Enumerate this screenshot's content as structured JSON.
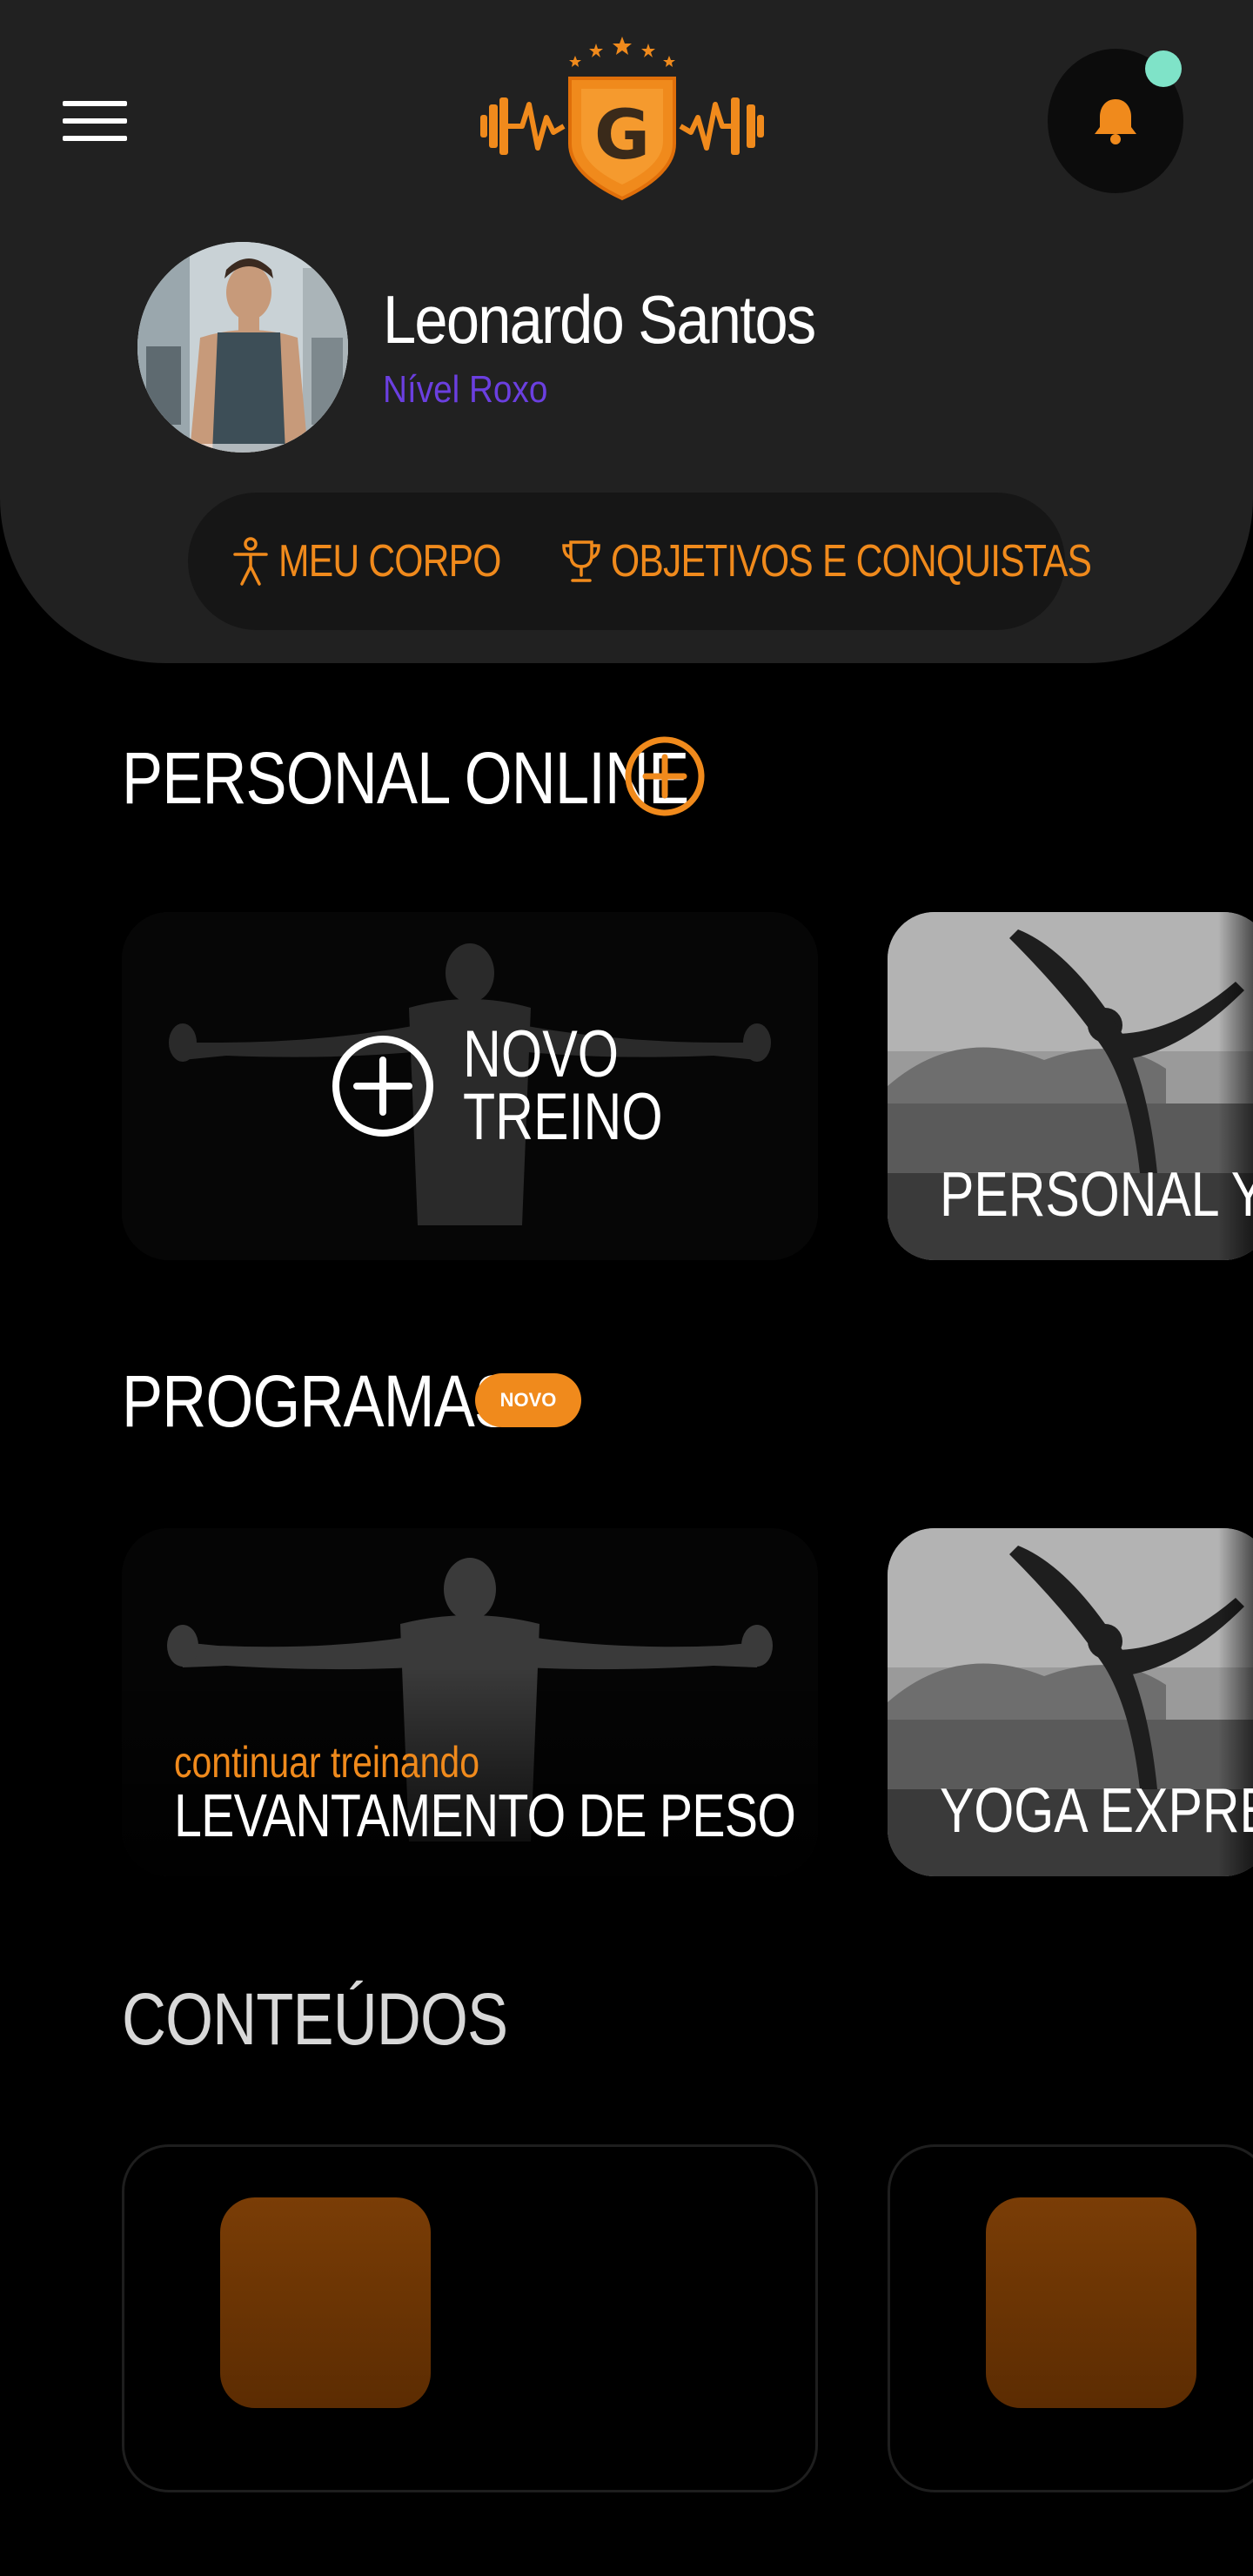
{
  "header": {
    "user": {
      "name": "Leonardo Santos",
      "level": "Nível Roxo"
    },
    "tabs": [
      {
        "label": "MEU CORPO",
        "icon": "person-icon"
      },
      {
        "label": "OBJETIVOS E CONQUISTAS",
        "icon": "trophy-icon"
      }
    ],
    "logo_letter": "G",
    "notification_icon": "bell-icon"
  },
  "sections": {
    "personal": {
      "title": "PERSONAL ONLINE",
      "cards": [
        {
          "label": "NOVO\nTREINO",
          "icon": "plus-circle-icon"
        },
        {
          "title": "PERSONAL YOGA"
        }
      ]
    },
    "programas": {
      "title": "PROGRAMAS",
      "badge": "NOVO",
      "cards": [
        {
          "subtitle": "continuar treinando",
          "title": "LEVANTAMENTO DE PESO"
        },
        {
          "title": "YOGA EXPRESS"
        }
      ]
    },
    "conteudos": {
      "title": "CONTEÚDOS"
    }
  },
  "colors": {
    "accent": "#f08a1c",
    "level": "#6b3fe0",
    "header_bg": "#212121",
    "page_bg": "#000000",
    "notification_dot": "#7fe3c8"
  }
}
